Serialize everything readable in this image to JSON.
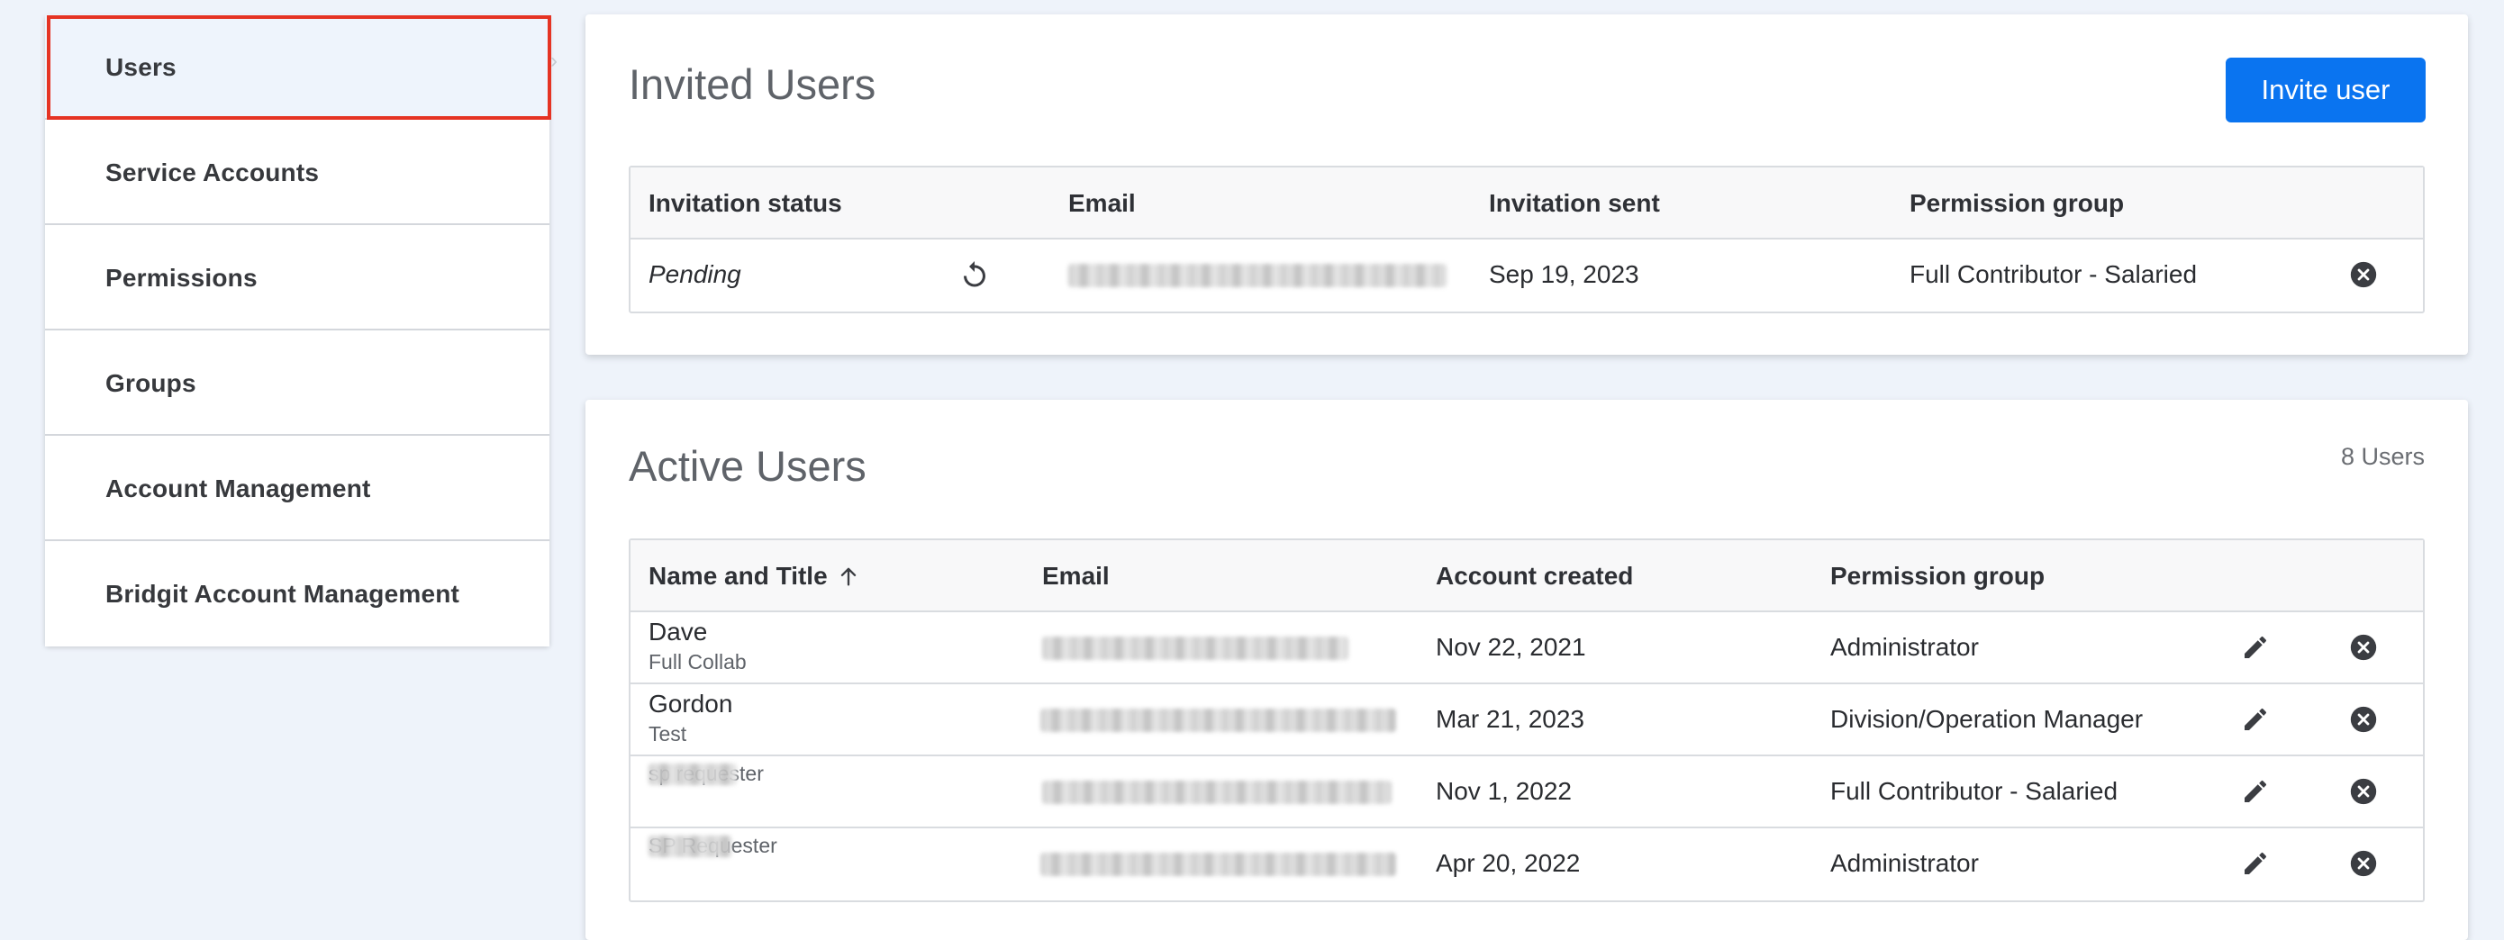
{
  "sidebar": {
    "items": [
      {
        "label": "Users"
      },
      {
        "label": "Service Accounts"
      },
      {
        "label": "Permissions"
      },
      {
        "label": "Groups"
      },
      {
        "label": "Account Management"
      },
      {
        "label": "Bridgit Account Management"
      }
    ],
    "active_index": 0
  },
  "invited": {
    "title": "Invited Users",
    "invite_button": "Invite user",
    "columns": [
      "Invitation status",
      "Email",
      "Invitation sent",
      "Permission group"
    ],
    "rows": [
      {
        "status": "Pending",
        "email": "",
        "sent": "Sep 19, 2023",
        "group": "Full Contributor - Salaried"
      }
    ]
  },
  "active": {
    "title": "Active Users",
    "count": "8 Users",
    "columns": [
      "Name and Title",
      "Email",
      "Account created",
      "Permission group"
    ],
    "sort_column": "Name and Title",
    "rows": [
      {
        "name": "Dave",
        "title": "Full Collab",
        "email": "",
        "created": "Nov 22, 2021",
        "group": "Administrator"
      },
      {
        "name": "Gordon",
        "title": "Test",
        "email": "",
        "created": "Mar 21, 2023",
        "group": "Division/Operation Manager"
      },
      {
        "name": "",
        "title": "sp requester",
        "email": "",
        "created": "Nov 1, 2022",
        "group": "Full Contributor - Salaried"
      },
      {
        "name": "",
        "title": "SP Requester",
        "email": "",
        "created": "Apr 20, 2022",
        "group": "Administrator"
      }
    ]
  },
  "colors": {
    "accent": "#0a74f0",
    "active_outline": "#e53323",
    "background": "#eef3fa"
  },
  "icons": {
    "resend": "resend-icon",
    "edit": "pencil-icon",
    "remove": "close-circle-icon",
    "sort": "arrow-up-icon",
    "chevron": "chevron-right-icon"
  }
}
